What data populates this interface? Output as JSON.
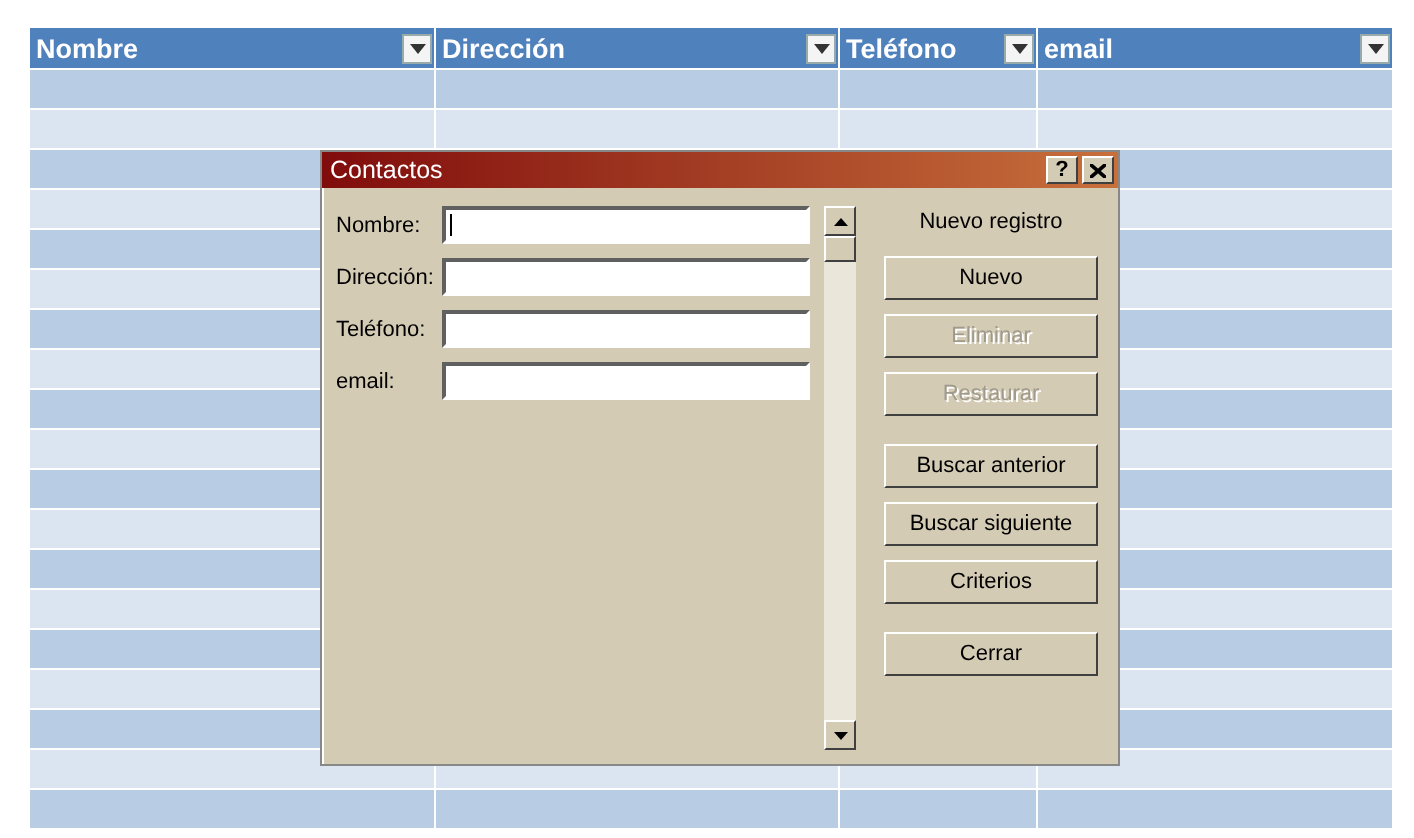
{
  "table": {
    "columns": [
      "Nombre",
      "Dirección",
      "Teléfono",
      "email"
    ]
  },
  "dialog": {
    "title": "Contactos",
    "help_button": "?",
    "fields": [
      {
        "label": "Nombre:",
        "focused": true
      },
      {
        "label": "Dirección:",
        "focused": false
      },
      {
        "label": "Teléfono:",
        "focused": false
      },
      {
        "label": "email:",
        "focused": false
      }
    ],
    "record_status": "Nuevo registro",
    "buttons": [
      {
        "label": "Nuevo",
        "disabled": false
      },
      {
        "label": "Eliminar",
        "disabled": true
      },
      {
        "label": "Restaurar",
        "disabled": true
      },
      {
        "label": "Buscar anterior",
        "disabled": false
      },
      {
        "label": "Buscar siguiente",
        "disabled": false
      },
      {
        "label": "Criterios",
        "disabled": false
      },
      {
        "label": "Cerrar",
        "disabled": false
      }
    ]
  }
}
